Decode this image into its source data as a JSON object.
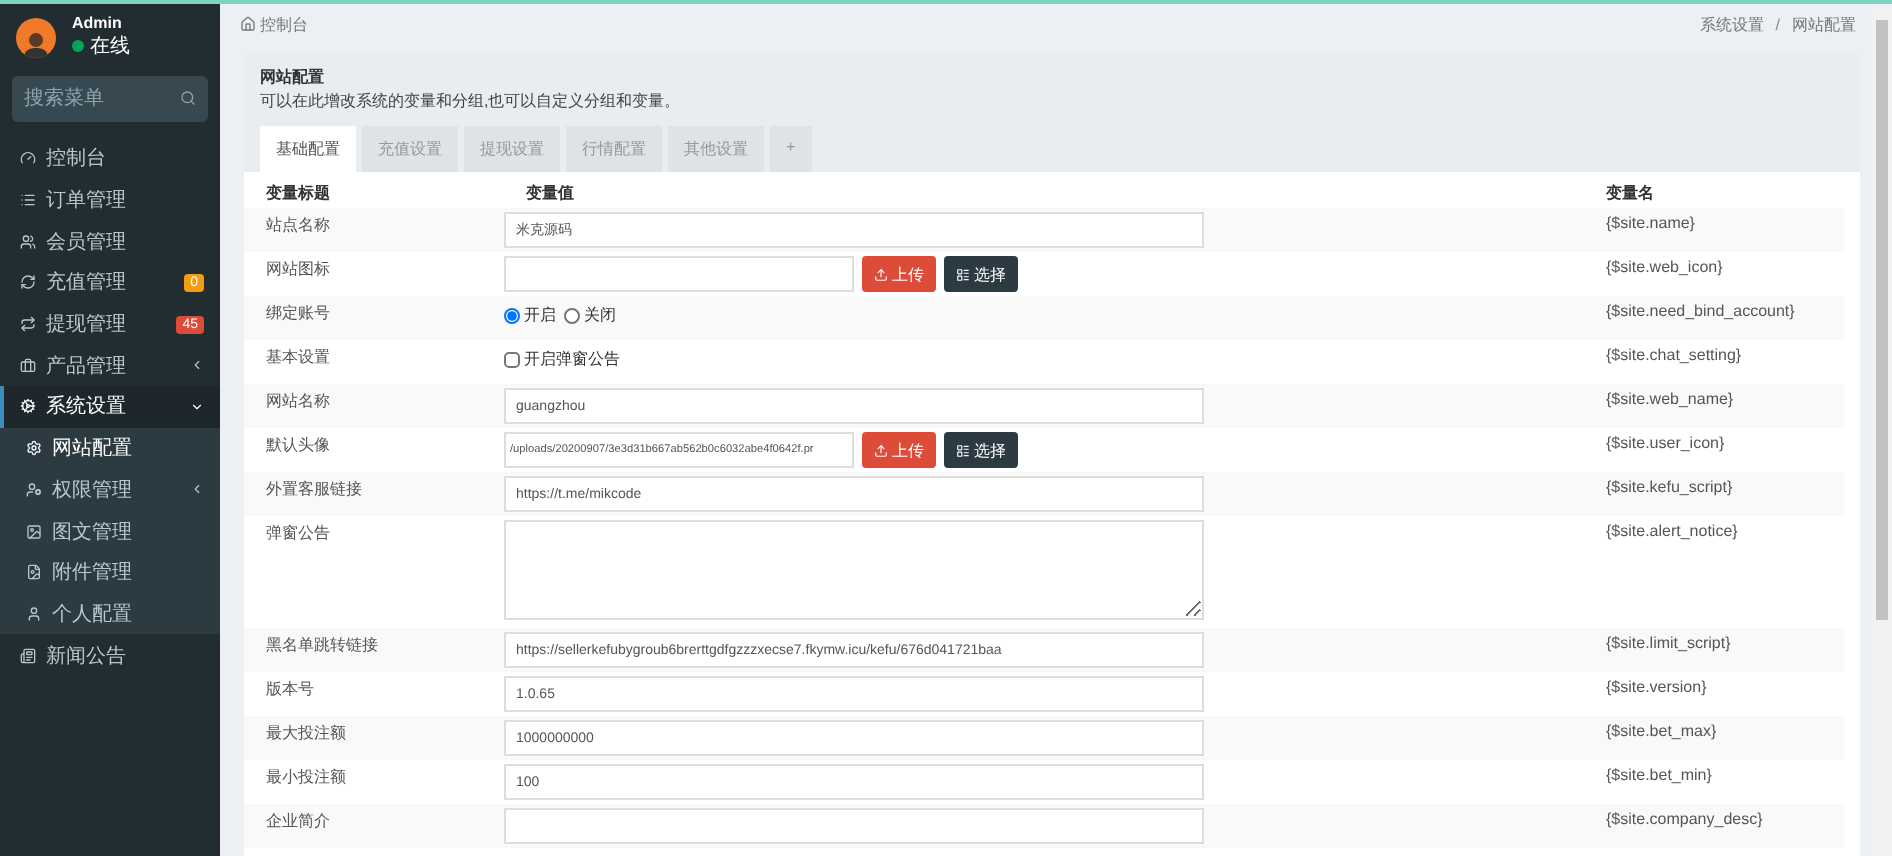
{
  "user": {
    "name": "Admin",
    "status": "在线"
  },
  "sidebar": {
    "search": {
      "placeholder": "搜索菜单"
    },
    "items": [
      {
        "label": "控制台",
        "selected": false
      },
      {
        "label": "订单管理",
        "selected": false
      },
      {
        "label": "会员管理",
        "selected": false
      },
      {
        "label": "充值管理",
        "selected": false,
        "badge": "0",
        "color": "#f39c12"
      },
      {
        "label": "提现管理",
        "selected": false,
        "badge": "45",
        "color": "#dd4b39"
      },
      {
        "label": "产品管理",
        "selected": false,
        "expanded": false
      },
      {
        "label": "系统设置",
        "selected": true,
        "expanded": true,
        "children": [
          {
            "label": "网站配置",
            "selected": true
          },
          {
            "label": "权限管理",
            "selected": false,
            "expanded": false
          },
          {
            "label": "图文管理",
            "selected": false
          },
          {
            "label": "附件管理",
            "selected": false
          },
          {
            "label": "个人配置",
            "selected": false
          }
        ]
      },
      {
        "label": "新闻公告",
        "selected": false
      }
    ]
  },
  "breadcrumb": {
    "home": "控制台",
    "trail": [
      "系统设置",
      "网站配置"
    ],
    "separator": "/"
  },
  "panel": {
    "title": "网站配置",
    "description": "可以在此增改系统的变量和分组,也可以自定义分组和变量。",
    "tabs": [
      {
        "label": "基础配置",
        "selected": true
      },
      {
        "label": "充值设置",
        "selected": false
      },
      {
        "label": "提现设置",
        "selected": false
      },
      {
        "label": "行情配置",
        "selected": false
      },
      {
        "label": "其他设置",
        "selected": false
      },
      {
        "label": "+",
        "selected": false
      }
    ]
  },
  "table": {
    "columns": [
      "变量标题",
      "变量值",
      "变量名"
    ],
    "rows": [
      {
        "kind": "text",
        "title": "站点名称",
        "value": "米克源码",
        "variable": "{$site.name}"
      },
      {
        "kind": "upload",
        "title": "网站图标",
        "upload": "上传",
        "choose": "选择",
        "variable": "{$site.web_icon}"
      },
      {
        "kind": "radio",
        "title": "绑定账号",
        "options": [
          {
            "label": "开启",
            "selected": true
          },
          {
            "label": "关闭",
            "selected": false
          }
        ],
        "variable": "{$site.need_bind_account}"
      },
      {
        "kind": "checkbox",
        "title": "基本设置",
        "label": "开启弹窗公告",
        "checked": false,
        "variable": "{$site.chat_setting}"
      },
      {
        "kind": "text",
        "title": "网站名称",
        "value": "guangzhou",
        "variable": "{$site.web_name}"
      },
      {
        "kind": "upload",
        "title": "默认头像",
        "value": "/uploads/20200907/3e3d31b667ab562b0c6032abe4f0642f.pr",
        "upload": "上传",
        "choose": "选择",
        "variable": "{$site.user_icon}"
      },
      {
        "kind": "text",
        "title": "外置客服链接",
        "value": "https://t.me/mikcode",
        "variable": "{$site.kefu_script}"
      },
      {
        "kind": "textarea",
        "title": "弹窗公告",
        "variable": "{$site.alert_notice}"
      },
      {
        "kind": "text",
        "title": "黑名单跳转链接",
        "value": "https://sellerkefubygroub6brerttgdfgzzzxecse7.fkymw.icu/kefu/676d041721baa",
        "variable": "{$site.limit_script}"
      },
      {
        "kind": "text",
        "title": "版本号",
        "value": "1.0.65",
        "variable": "{$site.version}"
      },
      {
        "kind": "text",
        "title": "最大投注额",
        "value": "1000000000",
        "variable": "{$site.bet_max}"
      },
      {
        "kind": "text",
        "title": "最小投注额",
        "value": "100",
        "variable": "{$site.bet_min}"
      },
      {
        "kind": "text",
        "title": "企业简介",
        "variable": "{$site.company_desc}"
      }
    ]
  }
}
